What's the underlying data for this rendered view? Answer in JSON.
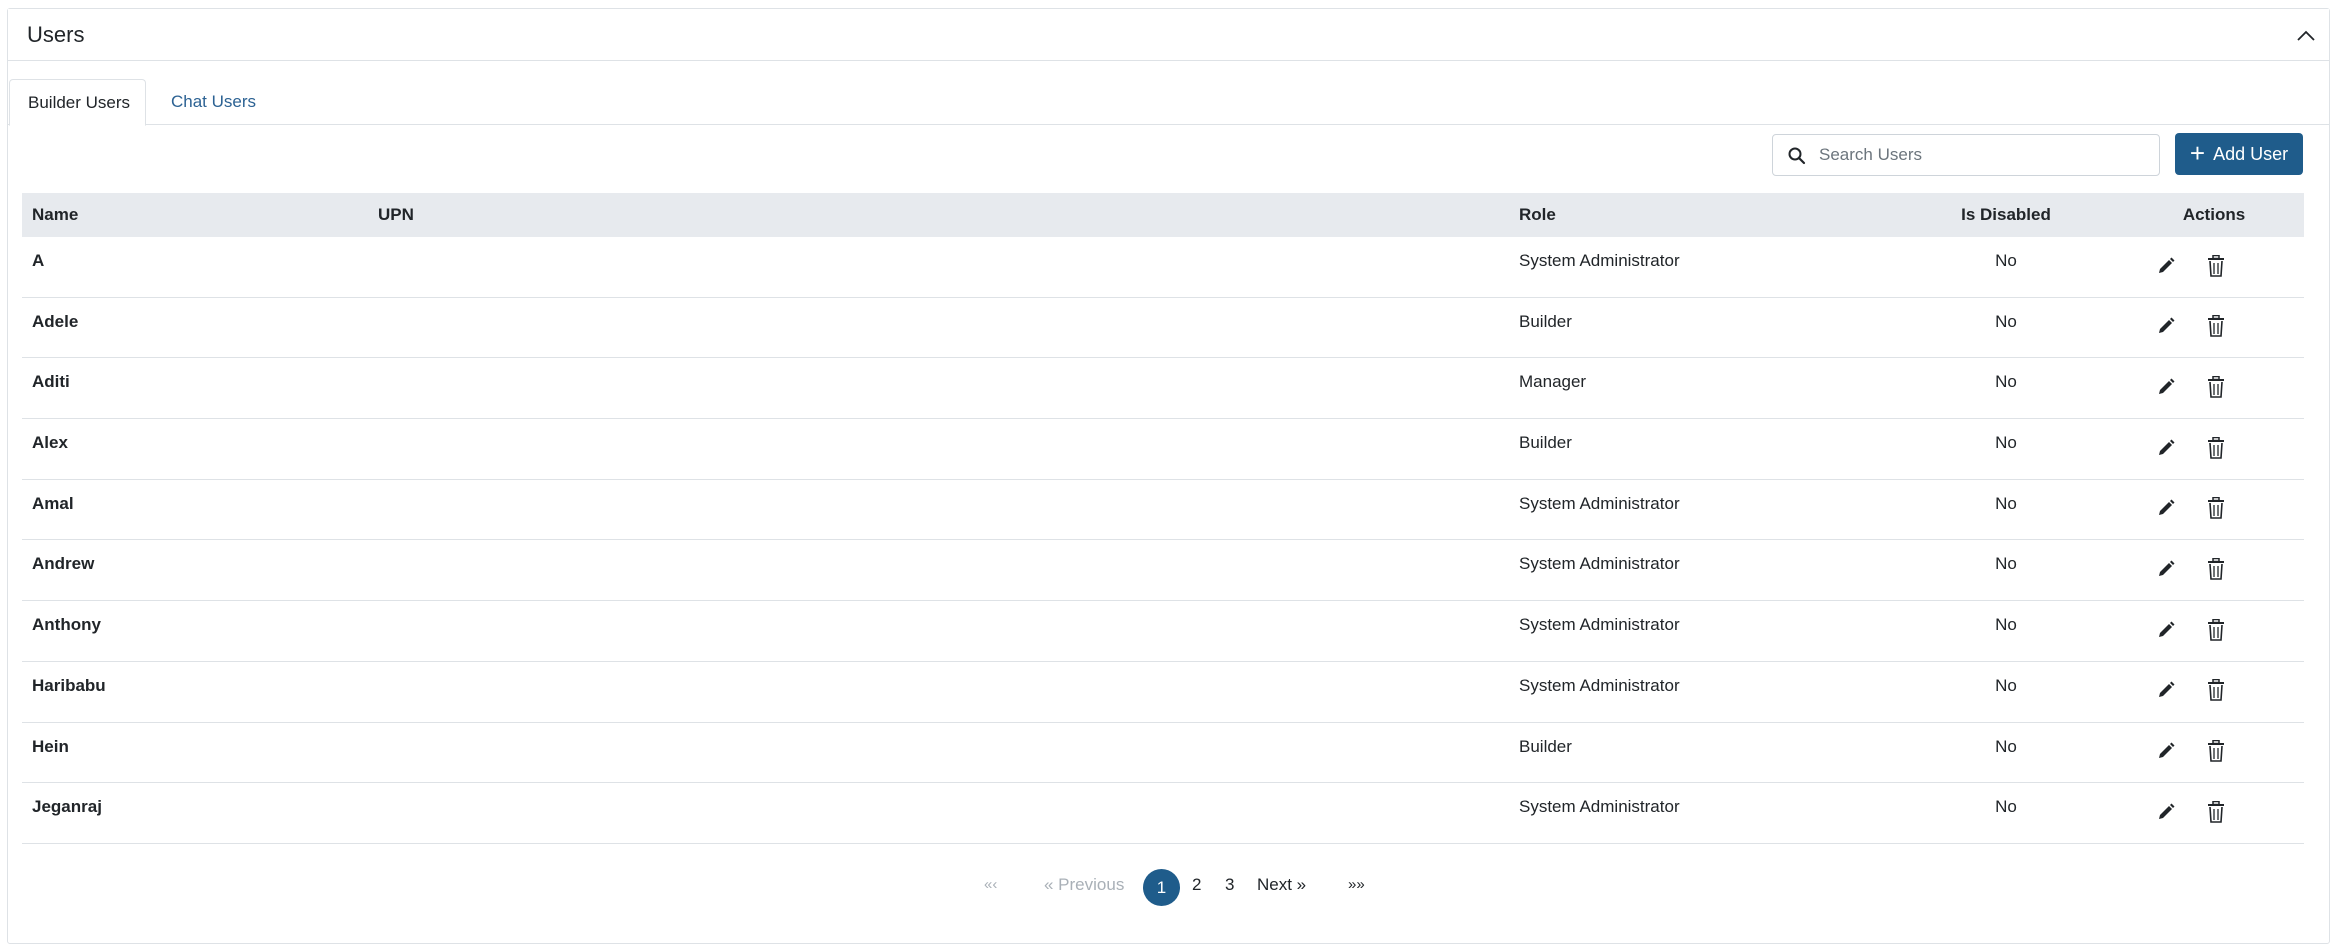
{
  "panel": {
    "title": "Users"
  },
  "tabs": [
    {
      "label": "Builder Users",
      "active": true
    },
    {
      "label": "Chat Users",
      "active": false
    }
  ],
  "toolbar": {
    "search_placeholder": "Search Users",
    "search_value": "",
    "add_label": "Add User",
    "add_icon": "plus-icon"
  },
  "table": {
    "headers": {
      "name": "Name",
      "upn": "UPN",
      "role": "Role",
      "is_disabled": "Is Disabled",
      "actions": "Actions"
    },
    "rows": [
      {
        "name": "A",
        "upn": "",
        "role": "System Administrator",
        "is_disabled": "No"
      },
      {
        "name": "Adele",
        "upn": "",
        "role": "Builder",
        "is_disabled": "No"
      },
      {
        "name": "Aditi",
        "upn": "",
        "role": "Manager",
        "is_disabled": "No"
      },
      {
        "name": "Alex",
        "upn": "",
        "role": "Builder",
        "is_disabled": "No"
      },
      {
        "name": "Amal",
        "upn": "",
        "role": "System Administrator",
        "is_disabled": "No"
      },
      {
        "name": "Andrew",
        "upn": "",
        "role": "System Administrator",
        "is_disabled": "No"
      },
      {
        "name": "Anthony",
        "upn": "",
        "role": "System Administrator",
        "is_disabled": "No"
      },
      {
        "name": "Haribabu",
        "upn": "",
        "role": "System Administrator",
        "is_disabled": "No"
      },
      {
        "name": "Hein",
        "upn": "",
        "role": "Builder",
        "is_disabled": "No"
      },
      {
        "name": "Jeganraj",
        "upn": "",
        "role": "System Administrator",
        "is_disabled": "No"
      }
    ]
  },
  "pagination": {
    "first": "«‹",
    "previous": "« Previous",
    "pages": [
      "1",
      "2",
      "3"
    ],
    "current_page": "1",
    "next": "Next »",
    "last": "»»"
  },
  "colors": {
    "primary": "#1f5c8b",
    "link": "#2c6293",
    "header_bg": "#e7eaee",
    "border": "#dee2e6"
  }
}
